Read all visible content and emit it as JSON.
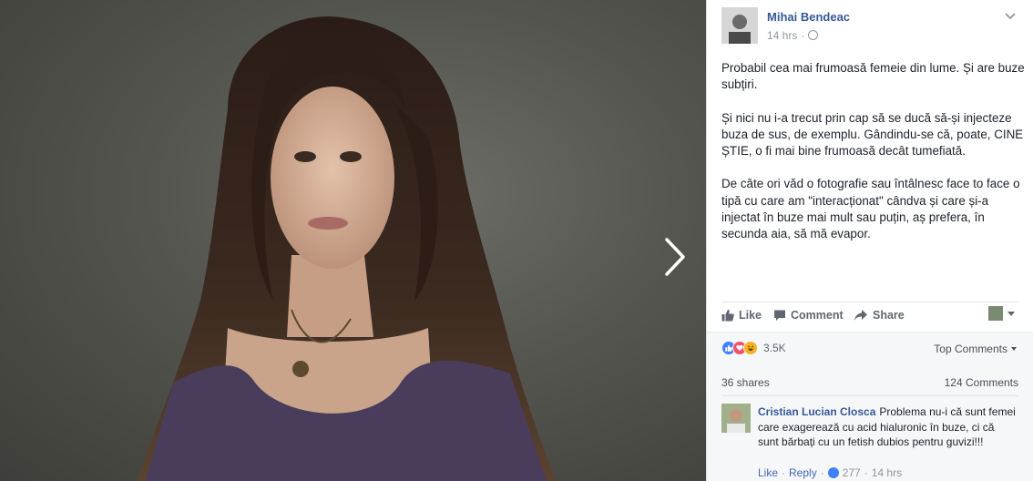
{
  "post": {
    "author": "Mihai Bendeac",
    "time": "14 hrs",
    "separator": "·",
    "paragraphs": [
      "Probabil cea mai frumoasă femeie din lume. Și are buze subțiri.",
      "Și nici nu i-a trecut prin cap să se ducă să-și injecteze buza de sus, de exemplu. Gândindu-se că, poate, CINE ȘTIE, o fi mai bine frumoasă decât tumefiată.",
      "De câte ori văd o fotografie sau întâlnesc face to face o tipă cu care am \"interacționat\" cândva și care și-a injectat în buze mai mult sau puțin, aș prefera, în secunda aia, să mă evapor."
    ]
  },
  "actions": {
    "like": "Like",
    "comment": "Comment",
    "share": "Share"
  },
  "stats": {
    "reactions_count": "3.5K",
    "top_comments": "Top Comments",
    "shares": "36 shares",
    "comments": "124 Comments"
  },
  "comment": {
    "name": "Cristian Lucian Closca",
    "text": "Problema nu-i că sunt femei care exagerează cu acid hialuronic în buze, ci că sunt bărbați cu un fetish dubios pentru guvizi!!!",
    "like": "Like",
    "reply": "Reply",
    "likes": "277",
    "time": "14 hrs",
    "dot": "·"
  },
  "icons": [
    "chevron-right-icon",
    "chevron-down-icon",
    "globe-icon",
    "thumbs-up-icon",
    "comment-icon",
    "share-arrow-icon",
    "like-reaction-icon",
    "love-reaction-icon",
    "haha-reaction-icon"
  ],
  "colors": {
    "link": "#365899",
    "photo_bg": "#55554f",
    "like_blue": "#4080ff",
    "love_red": "#f25268",
    "haha_yellow": "#f7b125"
  }
}
